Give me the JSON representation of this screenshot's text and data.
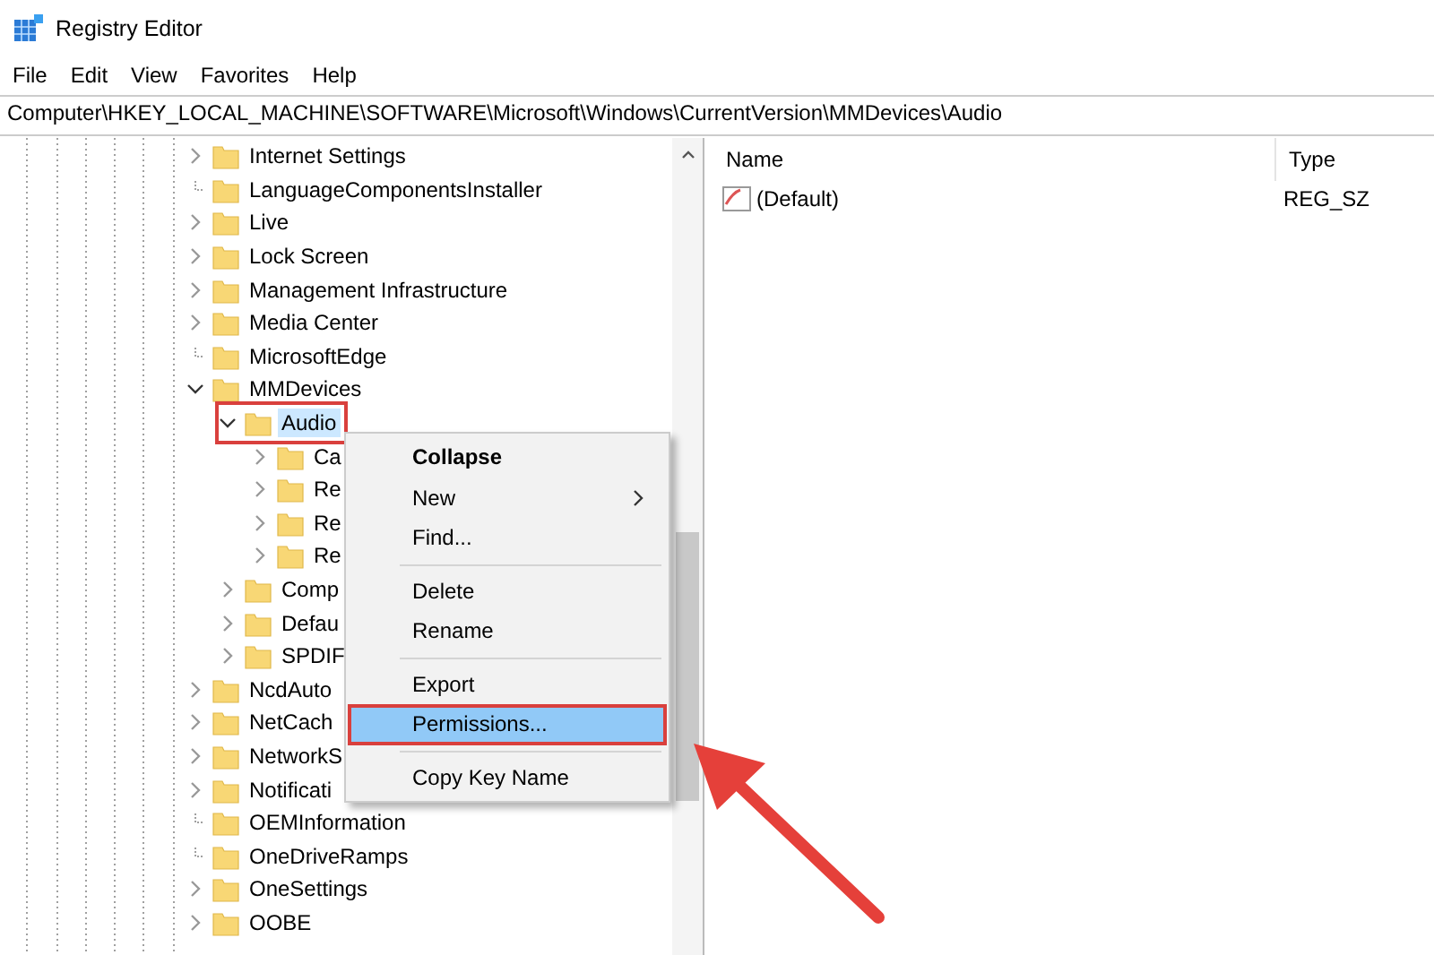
{
  "window": {
    "title": "Registry Editor"
  },
  "menu_bar": [
    "File",
    "Edit",
    "View",
    "Favorites",
    "Help"
  ],
  "address": "Computer\\HKEY_LOCAL_MACHINE\\SOFTWARE\\Microsoft\\Windows\\CurrentVersion\\MMDevices\\Audio",
  "tree": {
    "items": [
      {
        "label": "Internet Settings",
        "kind": "branch",
        "expanded": false,
        "selected": false,
        "highlighted": false
      },
      {
        "label": "LanguageComponentsInstaller",
        "kind": "leaf",
        "selected": false,
        "highlighted": false
      },
      {
        "label": "Live",
        "kind": "branch",
        "expanded": false,
        "selected": false,
        "highlighted": false
      },
      {
        "label": "Lock Screen",
        "kind": "branch",
        "expanded": false,
        "selected": false,
        "highlighted": false
      },
      {
        "label": "Management Infrastructure",
        "kind": "branch",
        "expanded": false,
        "selected": false,
        "highlighted": false
      },
      {
        "label": "Media Center",
        "kind": "branch",
        "expanded": false,
        "selected": false,
        "highlighted": false
      },
      {
        "label": "MicrosoftEdge",
        "kind": "leaf",
        "selected": false,
        "highlighted": false
      },
      {
        "label": "MMDevices",
        "kind": "branch",
        "expanded": true,
        "selected": false,
        "highlighted": false,
        "children": [
          {
            "label": "Audio",
            "kind": "branch",
            "expanded": true,
            "selected": true,
            "highlighted": true,
            "children": [
              {
                "label": "Ca",
                "kind": "branch",
                "expanded": false,
                "selected": false,
                "highlighted": false
              },
              {
                "label": "Re",
                "kind": "branch",
                "expanded": false,
                "selected": false,
                "highlighted": false
              },
              {
                "label": "Re",
                "kind": "branch",
                "expanded": false,
                "selected": false,
                "highlighted": false
              },
              {
                "label": "Re",
                "kind": "branch",
                "expanded": false,
                "selected": false,
                "highlighted": false
              }
            ]
          },
          {
            "label": "Comp",
            "kind": "branch",
            "expanded": false,
            "selected": false,
            "highlighted": false
          },
          {
            "label": "Defau",
            "kind": "branch",
            "expanded": false,
            "selected": false,
            "highlighted": false
          },
          {
            "label": "SPDIF",
            "kind": "branch",
            "expanded": false,
            "selected": false,
            "highlighted": false
          }
        ]
      },
      {
        "label": "NcdAuto",
        "kind": "branch",
        "expanded": false,
        "selected": false,
        "highlighted": false
      },
      {
        "label": "NetCach",
        "kind": "branch",
        "expanded": false,
        "selected": false,
        "highlighted": false
      },
      {
        "label": "NetworkS",
        "kind": "branch",
        "expanded": false,
        "selected": false,
        "highlighted": false
      },
      {
        "label": "Notificati",
        "kind": "branch",
        "expanded": false,
        "selected": false,
        "highlighted": false
      },
      {
        "label": "OEMInformation",
        "kind": "leaf",
        "selected": false,
        "highlighted": false
      },
      {
        "label": "OneDriveRamps",
        "kind": "leaf",
        "selected": false,
        "highlighted": false
      },
      {
        "label": "OneSettings",
        "kind": "branch",
        "expanded": false,
        "selected": false,
        "highlighted": false
      },
      {
        "label": "OOBE",
        "kind": "branch",
        "expanded": false,
        "selected": false,
        "highlighted": false
      }
    ]
  },
  "values": {
    "columns": [
      "Name",
      "Type"
    ],
    "rows": [
      {
        "name": "(Default)",
        "type": "REG_SZ"
      }
    ]
  },
  "context_menu": {
    "items": [
      {
        "kind": "item",
        "label": "Collapse",
        "default": true,
        "submenu": false,
        "selected": false,
        "highlighted": false
      },
      {
        "kind": "item",
        "label": "New",
        "default": false,
        "submenu": true,
        "selected": false,
        "highlighted": false
      },
      {
        "kind": "item",
        "label": "Find...",
        "default": false,
        "submenu": false,
        "selected": false,
        "highlighted": false
      },
      {
        "kind": "separator"
      },
      {
        "kind": "item",
        "label": "Delete",
        "default": false,
        "submenu": false,
        "selected": false,
        "highlighted": false
      },
      {
        "kind": "item",
        "label": "Rename",
        "default": false,
        "submenu": false,
        "selected": false,
        "highlighted": false
      },
      {
        "kind": "separator"
      },
      {
        "kind": "item",
        "label": "Export",
        "default": false,
        "submenu": false,
        "selected": false,
        "highlighted": false
      },
      {
        "kind": "item",
        "label": "Permissions...",
        "default": false,
        "submenu": false,
        "selected": true,
        "highlighted": true
      },
      {
        "kind": "separator"
      },
      {
        "kind": "item",
        "label": "Copy Key Name",
        "default": false,
        "submenu": false,
        "selected": false,
        "highlighted": false
      }
    ]
  }
}
